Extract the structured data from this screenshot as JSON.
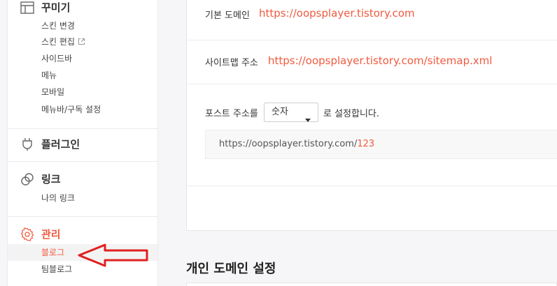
{
  "sidebar": {
    "groups": [
      {
        "icon": "layout-icon",
        "label": "꾸미기",
        "items": [
          "스킨 변경",
          "스킨 편집",
          "사이드바",
          "메뉴",
          "모바일",
          "메뉴바/구독 설정"
        ]
      },
      {
        "icon": "plug-icon",
        "label": "플러그인",
        "items": []
      },
      {
        "icon": "link-icon",
        "label": "링크",
        "items": [
          "나의 링크"
        ]
      },
      {
        "icon": "gear-icon",
        "label": "관리",
        "items": [
          "블로그",
          "팀블로그"
        ],
        "active": true,
        "active_item": "블로그"
      }
    ]
  },
  "settings": {
    "base_domain": {
      "label": "기본 도메인",
      "value": "https://oopsplayer.tistory.com"
    },
    "sitemap": {
      "label": "사이트맵 주소",
      "value": "https://oopsplayer.tistory.com/sitemap.xml"
    },
    "post_address": {
      "label": "포스트 주소를",
      "selected": "숫자",
      "suffix": "로 설정합니다.",
      "preview_prefix": "https://oopsplayer.tistory.com/",
      "preview_number": "123"
    }
  },
  "personal_domain": {
    "title": "개인 도메인 설정"
  },
  "colors": {
    "accent": "#f05a3e",
    "annotation": "#e02020"
  }
}
